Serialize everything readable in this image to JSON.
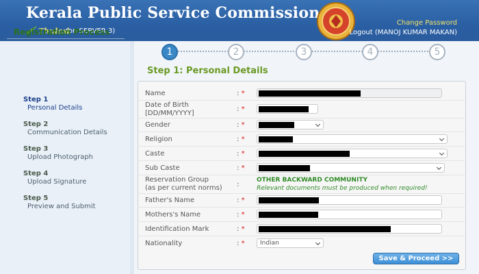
{
  "header": {
    "title": "Kerala Public Service Commission",
    "app_name": "Thulasi",
    "server": "(on SERVER-3)",
    "change_password": "Change Password",
    "logout": "Logout (MANOJ KUMAR MAKAN)"
  },
  "sidebar": {
    "title": "Registration Process",
    "steps": [
      {
        "num": "Step 1",
        "label": "Personal Details"
      },
      {
        "num": "Step 2",
        "label": "Communication Details"
      },
      {
        "num": "Step 3",
        "label": "Upload Photograph"
      },
      {
        "num": "Step 4",
        "label": "Upload Signature"
      },
      {
        "num": "Step 5",
        "label": "Preview and Submit"
      }
    ]
  },
  "progress": [
    "1",
    "2",
    "3",
    "4",
    "5"
  ],
  "main": {
    "step_title": "Step 1: Personal Details",
    "fields": {
      "name": "Name",
      "dob_line1": "Date of Birth",
      "dob_line2": "[DD/MM/YYYY]",
      "gender": "Gender",
      "religion": "Religion",
      "caste": "Caste",
      "sub_caste": "Sub Caste",
      "reservation_line1": "Reservation Group",
      "reservation_line2": "(as per current norms)",
      "fathers_name": "Father's Name",
      "mothers_name": "Mothers's Name",
      "identification_mark": "Identification Mark",
      "nationality": "Nationality"
    },
    "colon": ":",
    "required_marker": "*",
    "reservation_value": "OTHER BACKWARD COMMUNITY",
    "reservation_note": "Relevant documents must be produced when required!",
    "nationality_value": "Indian",
    "save_button": "Save & Proceed >>"
  },
  "colors": {
    "header_blue": "#2a5fa3",
    "step_title_green": "#6b9a24",
    "required_red": "#d51a1a",
    "active_step": "#3a88c6"
  }
}
